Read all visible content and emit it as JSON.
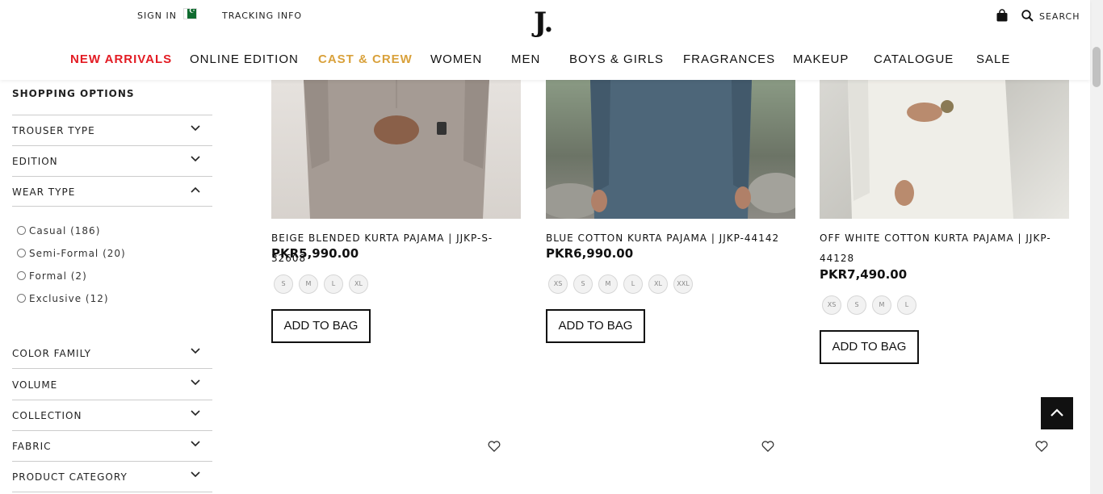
{
  "header": {
    "sign_in": "SIGN IN",
    "tracking": "TRACKING INFO",
    "logo": "J.",
    "search_label": "SEARCH"
  },
  "nav": {
    "items": [
      {
        "label": "NEW ARRIVALS",
        "color": "#e31b23"
      },
      {
        "label": "ONLINE EDITION",
        "color": "#111111"
      },
      {
        "label": "CAST & CREW",
        "color": "#d9a13b"
      },
      {
        "label": "WOMEN",
        "color": "#111111"
      },
      {
        "label": "MEN",
        "color": "#111111"
      },
      {
        "label": "BOYS & GIRLS",
        "color": "#111111"
      },
      {
        "label": "FRAGRANCES",
        "color": "#111111"
      },
      {
        "label": "MAKEUP",
        "color": "#111111"
      },
      {
        "label": "CATALOGUE",
        "color": "#111111"
      },
      {
        "label": "SALE",
        "color": "#111111"
      }
    ]
  },
  "sidebar": {
    "title": "SHOPPING OPTIONS",
    "filters_top": [
      {
        "label": "TROUSER TYPE",
        "expanded": false
      },
      {
        "label": "EDITION",
        "expanded": false
      },
      {
        "label": "WEAR TYPE",
        "expanded": true
      }
    ],
    "wear_type_options": [
      {
        "label": "Casual",
        "count": "(186)"
      },
      {
        "label": "Semi-Formal",
        "count": "(20)"
      },
      {
        "label": "Formal",
        "count": "(2)"
      },
      {
        "label": "Exclusive",
        "count": "(12)"
      }
    ],
    "filters_bottom": [
      {
        "label": "COLOR FAMILY",
        "expanded": false
      },
      {
        "label": "VOLUME",
        "expanded": false
      },
      {
        "label": "COLLECTION",
        "expanded": false
      },
      {
        "label": "FABRIC",
        "expanded": false
      },
      {
        "label": "PRODUCT CATEGORY",
        "expanded": false
      }
    ]
  },
  "products": [
    {
      "title": "BEIGE BLENDED KURTA PAJAMA | JJKP-S-32608",
      "price": "PKR5,990.00",
      "sizes": [
        "S",
        "M",
        "L",
        "XL"
      ],
      "button": "ADD TO BAG",
      "color": "#a59b94"
    },
    {
      "title": "BLUE COTTON KURTA PAJAMA | JJKP-44142",
      "price": "PKR6,990.00",
      "sizes": [
        "XS",
        "S",
        "M",
        "L",
        "XL",
        "XXL"
      ],
      "button": "ADD TO BAG",
      "color": "#4d6679"
    },
    {
      "title_line1": "OFF WHITE COTTON KURTA PAJAMA | JJKP-",
      "title_line2": "44128",
      "price": "PKR7,490.00",
      "sizes": [
        "XS",
        "S",
        "M",
        "L"
      ],
      "button": "ADD TO BAG",
      "color": "#ecebe4"
    }
  ]
}
